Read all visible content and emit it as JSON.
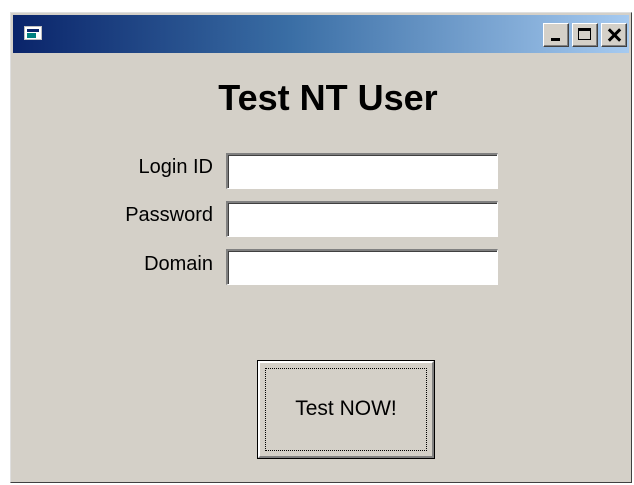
{
  "window": {
    "title": "",
    "app_icon": "form-window-icon",
    "controls": {
      "minimize_icon": "minimize-icon",
      "maximize_icon": "maximize-icon",
      "close_icon": "close-icon"
    },
    "titlebar_gradient": [
      "#0a246a",
      "#a6caf0"
    ],
    "face_color": "#d4d0c8"
  },
  "form": {
    "title": "Test NT User",
    "fields": {
      "login": {
        "label": "Login ID",
        "value": ""
      },
      "password": {
        "label": "Password",
        "value": ""
      },
      "domain": {
        "label": "Domain",
        "value": ""
      }
    },
    "submit_label": "Test NOW!"
  }
}
